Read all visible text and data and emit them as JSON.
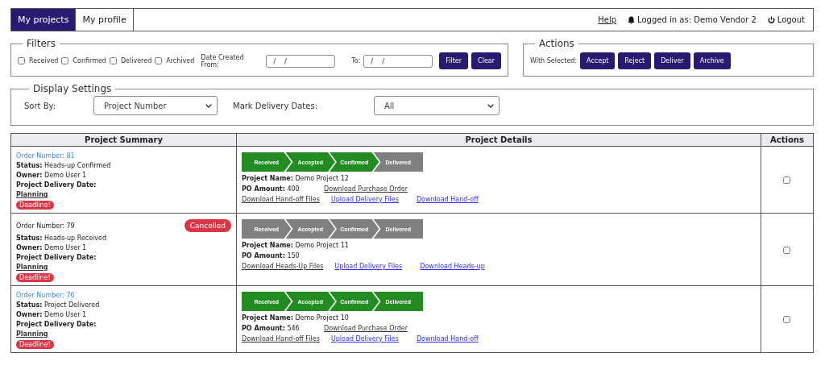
{
  "nav": {
    "tabs": [
      {
        "label": "My projects",
        "selected": true
      },
      {
        "label": "My profile",
        "selected": false
      }
    ],
    "help": "Help",
    "user": "Logged in as: Demo Vendor 2",
    "logout": "Logout"
  },
  "filters": {
    "title": "Filters",
    "checks": [
      {
        "label": "Received",
        "checked": false
      },
      {
        "label": "Confirmed",
        "checked": false
      },
      {
        "label": "Delivered",
        "checked": false
      },
      {
        "label": "Archived",
        "checked": false
      }
    ],
    "from_label": "Date Created From:",
    "from_placeholder": "/ /",
    "to_label": "To:",
    "to_placeholder": "/ /",
    "buttons": [
      "Filter",
      "Clear"
    ]
  },
  "actions": {
    "title": "Actions",
    "label": "With Selected:",
    "buttons": [
      "Accept",
      "Reject",
      "Deliver",
      "Archive"
    ]
  },
  "display": {
    "title": "Display Settings",
    "sort_label": "Sort By:",
    "sort_value": "Project Number",
    "mark_label": "Mark Delivery Dates:",
    "mark_value": "All"
  },
  "table": {
    "columns": [
      "Project Summary",
      "Project Details",
      "Actions"
    ],
    "rows": [
      {
        "order": "Order Number: 81",
        "order_link": true,
        "cancelled": null,
        "status_label": "Status:",
        "status": "Heads-up Confirmed",
        "owner_label": "Owner:",
        "owner": "Demo User 1",
        "date_label": "Project Delivery Date:",
        "planning": "Planning",
        "deadline": "Deadline!",
        "steps": [
          {
            "label": "Received",
            "done": true
          },
          {
            "label": "Accepted",
            "done": true
          },
          {
            "label": "Confirmed",
            "done": true
          },
          {
            "label": "Delivered",
            "done": false
          }
        ],
        "name_label": "Project Name:",
        "name": "Demo Project 12",
        "po_label": "PO Amount:",
        "po": "400",
        "po_link": "Download Purchase Order",
        "links": [
          {
            "label": "Download Hand-off Files",
            "kind": "dark"
          },
          {
            "label": "Upload Delivery Files",
            "kind": "blue"
          },
          {
            "label": "Download Hand-off",
            "kind": "blue"
          }
        ],
        "checked": false
      },
      {
        "order": "Order Number: 79",
        "order_link": false,
        "cancelled": "Cancelled",
        "status_label": "Status:",
        "status": "Heads-up Received",
        "owner_label": "Owner:",
        "owner": "Demo User 1",
        "date_label": "Project Delivery Date:",
        "planning": "Planning",
        "deadline": "Deadline!",
        "steps": [
          {
            "label": "Received",
            "done": false
          },
          {
            "label": "Accepted",
            "done": false
          },
          {
            "label": "Confirmed",
            "done": false
          },
          {
            "label": "Delivered",
            "done": false
          }
        ],
        "name_label": "Project Name:",
        "name": "Demo Project 11",
        "po_label": "PO Amount:",
        "po": "150",
        "po_link": null,
        "links": [
          {
            "label": "Download Heads-Up Files",
            "kind": "dark"
          },
          {
            "label": "Upload Delivery Files",
            "kind": "blue"
          },
          {
            "label": "Download Heads-up",
            "kind": "blue"
          }
        ],
        "checked": false
      },
      {
        "order": "Order Number: 76",
        "order_link": true,
        "cancelled": null,
        "status_label": "Status:",
        "status": "Project Delivered",
        "owner_label": "Owner:",
        "owner": "Demo User 1",
        "date_label": "Project Delivery Date:",
        "planning": "Planning",
        "deadline": "Deadline!",
        "steps": [
          {
            "label": "Received",
            "done": true
          },
          {
            "label": "Accepted",
            "done": true
          },
          {
            "label": "Confirmed",
            "done": true
          },
          {
            "label": "Delivered",
            "done": true
          }
        ],
        "name_label": "Project Name:",
        "name": "Demo Project 10",
        "po_label": "PO Amount:",
        "po": "546",
        "po_link": "Download Purchase Order",
        "links": [
          {
            "label": "Download Hand-off Files",
            "kind": "dark"
          },
          {
            "label": "Upload Delivery Files",
            "kind": "blue"
          },
          {
            "label": "Download Hand-off",
            "kind": "blue"
          }
        ],
        "checked": false
      }
    ]
  }
}
